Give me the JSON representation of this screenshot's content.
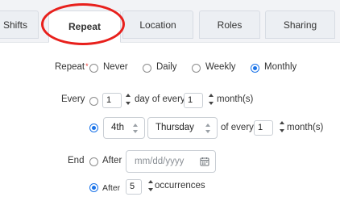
{
  "tabs": {
    "shifts": "Shifts",
    "repeat": "Repeat",
    "location": "Location",
    "roles": "Roles",
    "sharing": "Sharing",
    "active": "Repeat"
  },
  "repeat": {
    "label": "Repeat",
    "required_mark": "*",
    "options": [
      "Never",
      "Daily",
      "Weekly",
      "Monthly"
    ],
    "selected": "Monthly"
  },
  "every": {
    "label": "Every",
    "day_value": "1",
    "day_of_every_text": "day of every",
    "month_value": "1",
    "months_text": "month(s)",
    "ordinal_value": "4th",
    "weekday_value": "Thursday",
    "of_every_text": "of every",
    "month_value_2": "1",
    "months_text_2": "month(s)",
    "selected_option": "ordinal-weekday"
  },
  "end": {
    "label": "End",
    "after_date_label": "After",
    "date_placeholder": "mm/dd/yyyy",
    "after_count_label": "After",
    "occurrences_value": "5",
    "occurrences_text": "occurrences",
    "selected_option": "after-occurrences"
  },
  "colors": {
    "accent": "#1a73e8",
    "highlight_ring": "#e8201c",
    "required": "#e53935"
  },
  "icons": {
    "calendar": "calendar-icon",
    "spinner": "spinner-arrows-icon",
    "select_chevron": "chevron-updown-icon"
  }
}
